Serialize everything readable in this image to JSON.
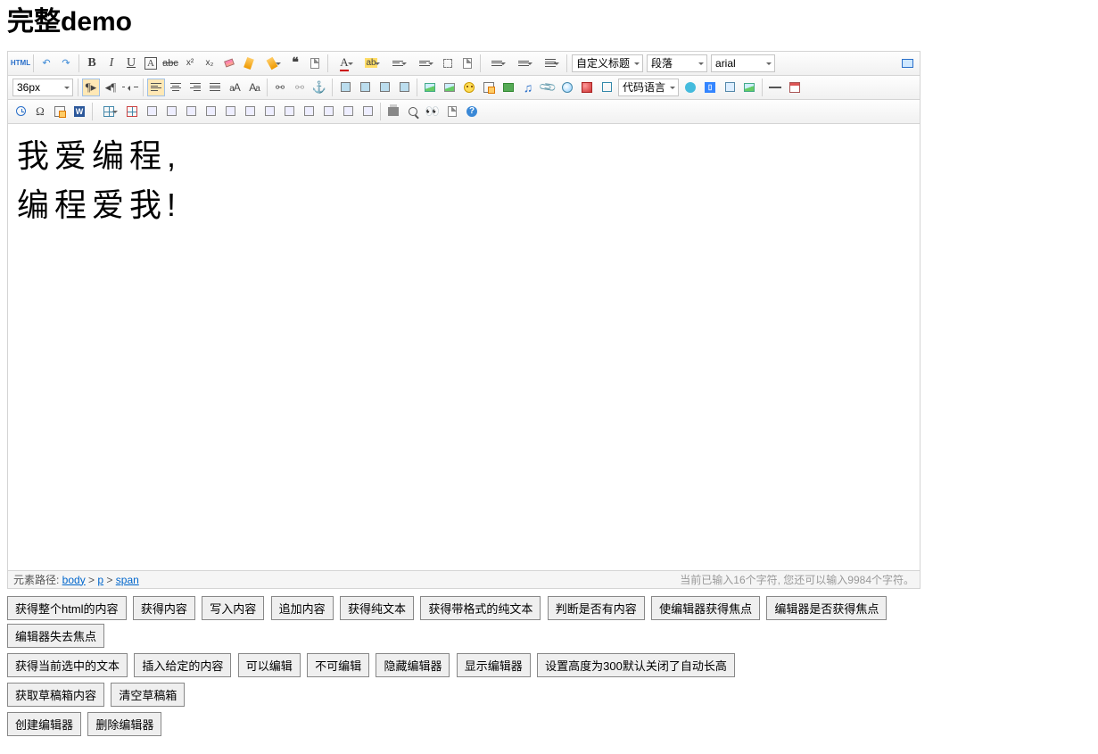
{
  "title": "完整demo",
  "toolbar": {
    "selectors": {
      "custom_title": "自定义标题",
      "paragraph": "段落",
      "font_family": "arial",
      "font_size": "36px",
      "code_lang": "代码语言"
    }
  },
  "content": {
    "line1": "我爱编程,",
    "line2": "编程爱我!"
  },
  "statusbar": {
    "path_label": "元素路径: ",
    "path_body": "body",
    "sep": " > ",
    "path_p": "p",
    "path_span": "span",
    "wordcount": "当前已输入16个字符, 您还可以输入9984个字符。"
  },
  "buttons": {
    "row1": [
      "获得整个html的内容",
      "获得内容",
      "写入内容",
      "追加内容",
      "获得纯文本",
      "获得带格式的纯文本",
      "判断是否有内容",
      "使编辑器获得焦点",
      "编辑器是否获得焦点",
      "编辑器失去焦点"
    ],
    "row2": [
      "获得当前选中的文本",
      "插入给定的内容",
      "可以编辑",
      "不可编辑",
      "隐藏编辑器",
      "显示编辑器",
      "设置高度为300默认关闭了自动长高"
    ],
    "row3": [
      "获取草稿箱内容",
      "清空草稿箱"
    ],
    "row4": [
      "创建编辑器",
      "删除编辑器"
    ]
  }
}
